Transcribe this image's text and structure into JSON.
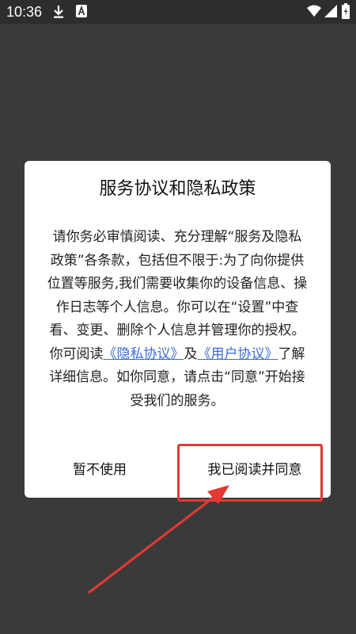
{
  "status_bar": {
    "time": "10:36",
    "left_icons": [
      "download-icon",
      "font-app-icon"
    ],
    "right_icons": [
      "wifi-icon",
      "signal-icon",
      "battery-icon"
    ]
  },
  "dialog": {
    "title": "服务协议和隐私政策",
    "body_text_1": "请你务必审慎阅读、充分理解“服务及隐私政策”各条款，包括但不限于:为了向你提供位置等服务,我们需要收集你的设备信息、操作日志等个人信息。你可以在“设置”中查看、变更、删除个人信息并管理你的授权。",
    "body_text_2_prefix": "你可阅读",
    "privacy_link": "《隐私协议》",
    "body_text_2_and": "及",
    "user_link": "《用户协议》",
    "body_text_2_suffix": "了解详细信息。如你同意，请点击“同意”开始接受我们的服务。",
    "decline_button": "暂不使用",
    "agree_button": "我已阅读并同意"
  },
  "annotation": {
    "color": "#e53935"
  }
}
